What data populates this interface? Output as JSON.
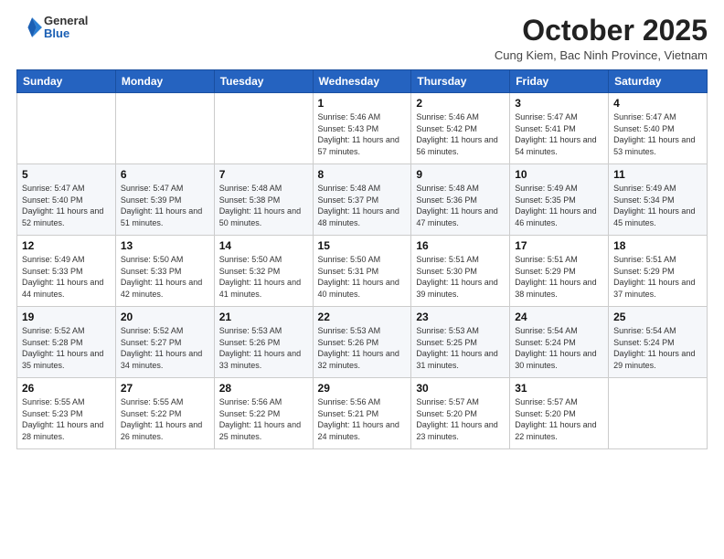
{
  "logo": {
    "general": "General",
    "blue": "Blue"
  },
  "header": {
    "month": "October 2025",
    "location": "Cung Kiem, Bac Ninh Province, Vietnam"
  },
  "weekdays": [
    "Sunday",
    "Monday",
    "Tuesday",
    "Wednesday",
    "Thursday",
    "Friday",
    "Saturday"
  ],
  "weeks": [
    [
      {
        "day": "",
        "content": ""
      },
      {
        "day": "",
        "content": ""
      },
      {
        "day": "",
        "content": ""
      },
      {
        "day": "1",
        "content": "Sunrise: 5:46 AM\nSunset: 5:43 PM\nDaylight: 11 hours and 57 minutes."
      },
      {
        "day": "2",
        "content": "Sunrise: 5:46 AM\nSunset: 5:42 PM\nDaylight: 11 hours and 56 minutes."
      },
      {
        "day": "3",
        "content": "Sunrise: 5:47 AM\nSunset: 5:41 PM\nDaylight: 11 hours and 54 minutes."
      },
      {
        "day": "4",
        "content": "Sunrise: 5:47 AM\nSunset: 5:40 PM\nDaylight: 11 hours and 53 minutes."
      }
    ],
    [
      {
        "day": "5",
        "content": "Sunrise: 5:47 AM\nSunset: 5:40 PM\nDaylight: 11 hours and 52 minutes."
      },
      {
        "day": "6",
        "content": "Sunrise: 5:47 AM\nSunset: 5:39 PM\nDaylight: 11 hours and 51 minutes."
      },
      {
        "day": "7",
        "content": "Sunrise: 5:48 AM\nSunset: 5:38 PM\nDaylight: 11 hours and 50 minutes."
      },
      {
        "day": "8",
        "content": "Sunrise: 5:48 AM\nSunset: 5:37 PM\nDaylight: 11 hours and 48 minutes."
      },
      {
        "day": "9",
        "content": "Sunrise: 5:48 AM\nSunset: 5:36 PM\nDaylight: 11 hours and 47 minutes."
      },
      {
        "day": "10",
        "content": "Sunrise: 5:49 AM\nSunset: 5:35 PM\nDaylight: 11 hours and 46 minutes."
      },
      {
        "day": "11",
        "content": "Sunrise: 5:49 AM\nSunset: 5:34 PM\nDaylight: 11 hours and 45 minutes."
      }
    ],
    [
      {
        "day": "12",
        "content": "Sunrise: 5:49 AM\nSunset: 5:33 PM\nDaylight: 11 hours and 44 minutes."
      },
      {
        "day": "13",
        "content": "Sunrise: 5:50 AM\nSunset: 5:33 PM\nDaylight: 11 hours and 42 minutes."
      },
      {
        "day": "14",
        "content": "Sunrise: 5:50 AM\nSunset: 5:32 PM\nDaylight: 11 hours and 41 minutes."
      },
      {
        "day": "15",
        "content": "Sunrise: 5:50 AM\nSunset: 5:31 PM\nDaylight: 11 hours and 40 minutes."
      },
      {
        "day": "16",
        "content": "Sunrise: 5:51 AM\nSunset: 5:30 PM\nDaylight: 11 hours and 39 minutes."
      },
      {
        "day": "17",
        "content": "Sunrise: 5:51 AM\nSunset: 5:29 PM\nDaylight: 11 hours and 38 minutes."
      },
      {
        "day": "18",
        "content": "Sunrise: 5:51 AM\nSunset: 5:29 PM\nDaylight: 11 hours and 37 minutes."
      }
    ],
    [
      {
        "day": "19",
        "content": "Sunrise: 5:52 AM\nSunset: 5:28 PM\nDaylight: 11 hours and 35 minutes."
      },
      {
        "day": "20",
        "content": "Sunrise: 5:52 AM\nSunset: 5:27 PM\nDaylight: 11 hours and 34 minutes."
      },
      {
        "day": "21",
        "content": "Sunrise: 5:53 AM\nSunset: 5:26 PM\nDaylight: 11 hours and 33 minutes."
      },
      {
        "day": "22",
        "content": "Sunrise: 5:53 AM\nSunset: 5:26 PM\nDaylight: 11 hours and 32 minutes."
      },
      {
        "day": "23",
        "content": "Sunrise: 5:53 AM\nSunset: 5:25 PM\nDaylight: 11 hours and 31 minutes."
      },
      {
        "day": "24",
        "content": "Sunrise: 5:54 AM\nSunset: 5:24 PM\nDaylight: 11 hours and 30 minutes."
      },
      {
        "day": "25",
        "content": "Sunrise: 5:54 AM\nSunset: 5:24 PM\nDaylight: 11 hours and 29 minutes."
      }
    ],
    [
      {
        "day": "26",
        "content": "Sunrise: 5:55 AM\nSunset: 5:23 PM\nDaylight: 11 hours and 28 minutes."
      },
      {
        "day": "27",
        "content": "Sunrise: 5:55 AM\nSunset: 5:22 PM\nDaylight: 11 hours and 26 minutes."
      },
      {
        "day": "28",
        "content": "Sunrise: 5:56 AM\nSunset: 5:22 PM\nDaylight: 11 hours and 25 minutes."
      },
      {
        "day": "29",
        "content": "Sunrise: 5:56 AM\nSunset: 5:21 PM\nDaylight: 11 hours and 24 minutes."
      },
      {
        "day": "30",
        "content": "Sunrise: 5:57 AM\nSunset: 5:20 PM\nDaylight: 11 hours and 23 minutes."
      },
      {
        "day": "31",
        "content": "Sunrise: 5:57 AM\nSunset: 5:20 PM\nDaylight: 11 hours and 22 minutes."
      },
      {
        "day": "",
        "content": ""
      }
    ]
  ]
}
